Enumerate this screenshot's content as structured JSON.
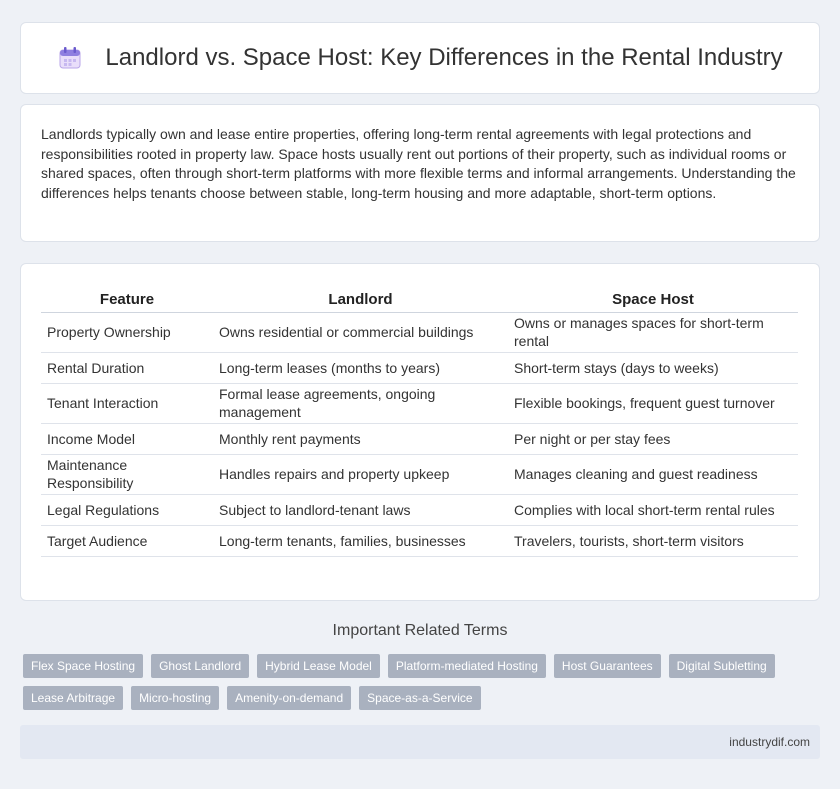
{
  "header": {
    "title": "Landlord vs. Space Host: Key Differences in the Rental Industry",
    "icon": "calendar-icon"
  },
  "intro": {
    "text": "Landlords typically own and lease entire properties, offering long-term rental agreements with legal protections and responsibilities rooted in property law. Space hosts usually rent out portions of their property, such as individual rooms or shared spaces, often through short-term platforms with more flexible terms and informal arrangements. Understanding the differences helps tenants choose between stable, long-term housing and more adaptable, short-term options."
  },
  "table": {
    "headers": [
      "Feature",
      "Landlord",
      "Space Host"
    ],
    "rows": [
      [
        "Property Ownership",
        "Owns residential or commercial buildings",
        "Owns or manages spaces for short-term rental"
      ],
      [
        "Rental Duration",
        "Long-term leases (months to years)",
        "Short-term stays (days to weeks)"
      ],
      [
        "Tenant Interaction",
        "Formal lease agreements, ongoing management",
        "Flexible bookings, frequent guest turnover"
      ],
      [
        "Income Model",
        "Monthly rent payments",
        "Per night or per stay fees"
      ],
      [
        "Maintenance Responsibility",
        "Handles repairs and property upkeep",
        "Manages cleaning and guest readiness"
      ],
      [
        "Legal Regulations",
        "Subject to landlord-tenant laws",
        "Complies with local short-term rental rules"
      ],
      [
        "Target Audience",
        "Long-term tenants, families, businesses",
        "Travelers, tourists, short-term visitors"
      ]
    ]
  },
  "related": {
    "title": "Important Related Terms",
    "tags_row1": [
      "Flex Space Hosting",
      "Ghost Landlord",
      "Hybrid Lease Model",
      "Platform-mediated Hosting",
      "Host Guarantees",
      "Digital Subletting"
    ],
    "tags_row2": [
      "Lease Arbitrage",
      "Micro-hosting",
      "Amenity-on-demand",
      "Space-as-a-Service"
    ]
  },
  "footer": {
    "source": "industrydif.com"
  },
  "colors": {
    "tag_bg": "#a9b1bf",
    "page_bg": "#eef1f6",
    "footer_bg": "#e3e8f2"
  }
}
